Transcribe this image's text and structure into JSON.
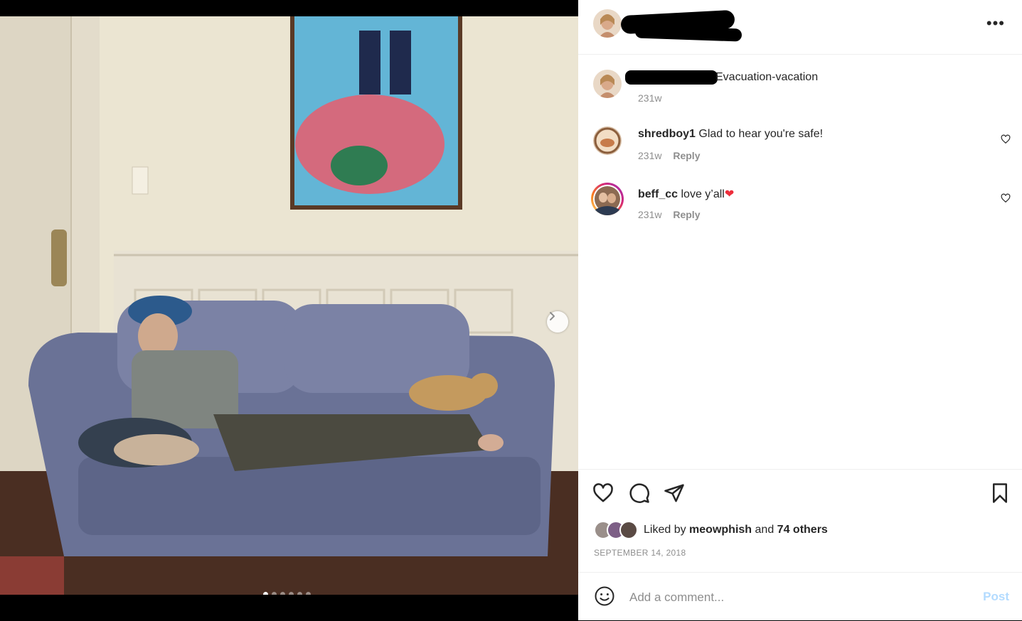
{
  "post": {
    "caption": {
      "text": "Evacuation-vacation",
      "time": "231w"
    },
    "comments": [
      {
        "username": "shredboy1",
        "text": "Glad to hear you're safe!",
        "time": "231w",
        "reply": "Reply"
      },
      {
        "username": "beff_cc",
        "text": "love y’all",
        "emoji": "❤",
        "time": "231w",
        "reply": "Reply"
      }
    ],
    "likes": {
      "prefix": "Liked by",
      "user": "meowphish",
      "and": "and",
      "others": "74 others"
    },
    "date": "SEPTEMBER 14, 2018",
    "add_comment_placeholder": "Add a comment...",
    "post_button": "Post"
  },
  "carousel": {
    "count": 6,
    "active": 1
  },
  "icons": {
    "more": "more-options-icon",
    "like": "heart-icon",
    "comment": "comment-icon",
    "share": "share-icon",
    "save": "bookmark-icon",
    "emoji": "emoji-icon",
    "next": "chevron-right-icon"
  },
  "colors": {
    "heart_red": "#ed2e3b",
    "post_button": "#b3dbff",
    "muted": "#8e8e8e"
  }
}
